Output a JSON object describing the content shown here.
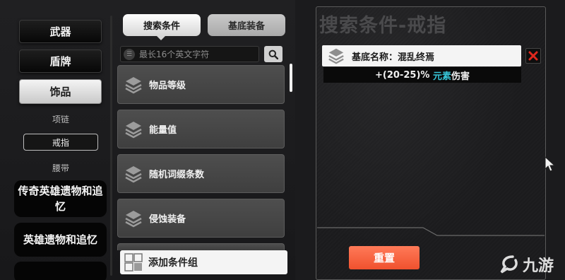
{
  "categories": {
    "weapons": "武器",
    "shields": "盾牌",
    "accessories": "饰品",
    "sub_items": [
      "项链",
      "戒指",
      "腰带"
    ],
    "legendary": "传奇英雄遗物和追忆",
    "hero_relics": "英雄遗物和追忆"
  },
  "tabs": {
    "search_conditions": "搜索条件",
    "base_equipment": "基底装备"
  },
  "search": {
    "placeholder": "最长16个英文字符",
    "value": ""
  },
  "conditions": [
    "物品等级",
    "能量值",
    "随机词缀条数",
    "侵蚀装备"
  ],
  "add_group_label": "添加条件组",
  "panel": {
    "title": "搜索条件-戒指",
    "base_label": "基底名称：混乱终焉",
    "affix_prefix": "+(20-25)% ",
    "affix_highlight": "元素",
    "affix_suffix": "伤害",
    "reset_label": "重置"
  },
  "watermark": {
    "text": "九游"
  },
  "colors": {
    "accent_reset": "#f0512e",
    "affix_highlight": "#37c6d8",
    "delete_x": "#e0281e"
  },
  "icons": {
    "search": "search-icon",
    "layers": "layers-icon",
    "delete": "close-icon",
    "add_group": "grid-add-icon",
    "cursor": "mouse-pointer-icon"
  }
}
